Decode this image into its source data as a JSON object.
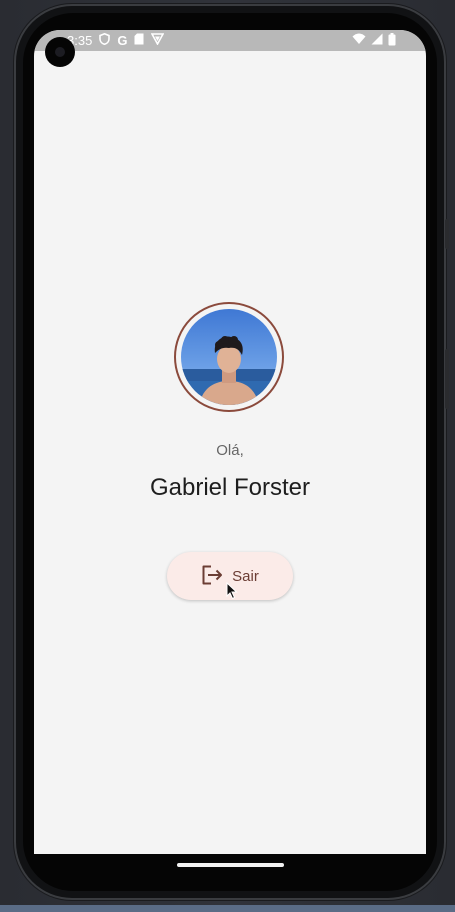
{
  "status_bar": {
    "time": "3:35",
    "left_icons": [
      "shield-icon",
      "google-g-icon",
      "sd-card-icon",
      "vpn-icon"
    ],
    "google_glyph": "G",
    "right_icons": [
      "wifi-icon",
      "cell-signal-icon",
      "battery-icon"
    ]
  },
  "profile": {
    "greeting": "Olá,",
    "name": "Gabriel Forster",
    "avatar_border_color": "#8b4a3c"
  },
  "logout_button": {
    "label": "Sair",
    "icon": "logout-icon",
    "background": "#fbebe8"
  }
}
